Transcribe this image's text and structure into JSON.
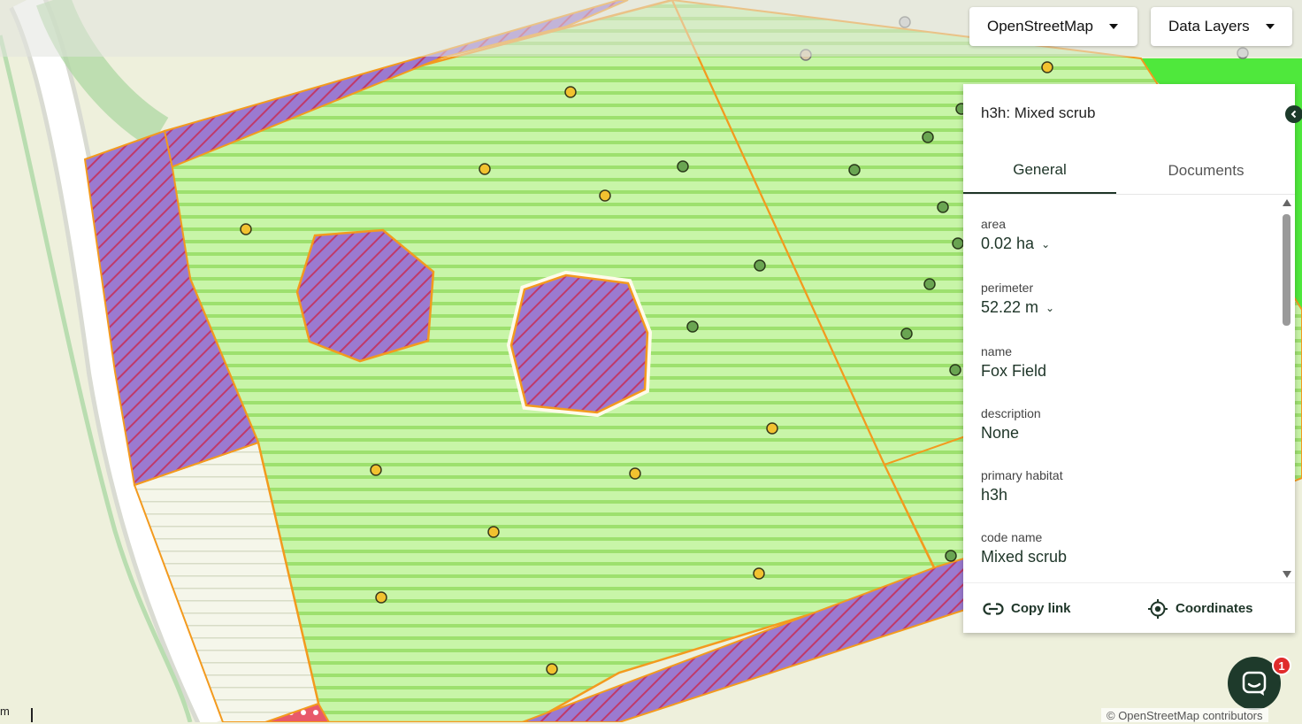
{
  "basemap_button": {
    "label": "OpenStreetMap"
  },
  "layers_button": {
    "label": "Data Layers"
  },
  "panel": {
    "title": "h3h: Mixed scrub",
    "tabs": [
      {
        "label": "General"
      },
      {
        "label": "Documents"
      }
    ],
    "fields": [
      {
        "label": "area",
        "value": "0.02 ha",
        "has_unit_toggle": true
      },
      {
        "label": "perimeter",
        "value": "52.22 m",
        "has_unit_toggle": true
      },
      {
        "label": "name",
        "value": "Fox Field"
      },
      {
        "label": "description",
        "value": "None"
      },
      {
        "label": "primary habitat",
        "value": "h3h"
      },
      {
        "label": "code name",
        "value": "Mixed scrub"
      }
    ],
    "actions": {
      "copy_link": "Copy link",
      "coordinates": "Coordinates"
    }
  },
  "chat": {
    "badge_count": "1"
  },
  "map": {
    "attribution": "© OpenStreetMap contributors",
    "scale_label": "m",
    "colors": {
      "field_fill": "#c8f5a8",
      "field_stripe": "#9de06e",
      "boundary": "#f39a1e",
      "scrub_fill": "#9b7ad0",
      "scrub_hatch": "#c0396a",
      "grassland": "#4fe83c",
      "point_yellow": "#f2c230",
      "point_green": "#6aa552",
      "point_grey": "#c8c8c8",
      "road": "#ffffff",
      "background": "#eef0dc"
    }
  }
}
